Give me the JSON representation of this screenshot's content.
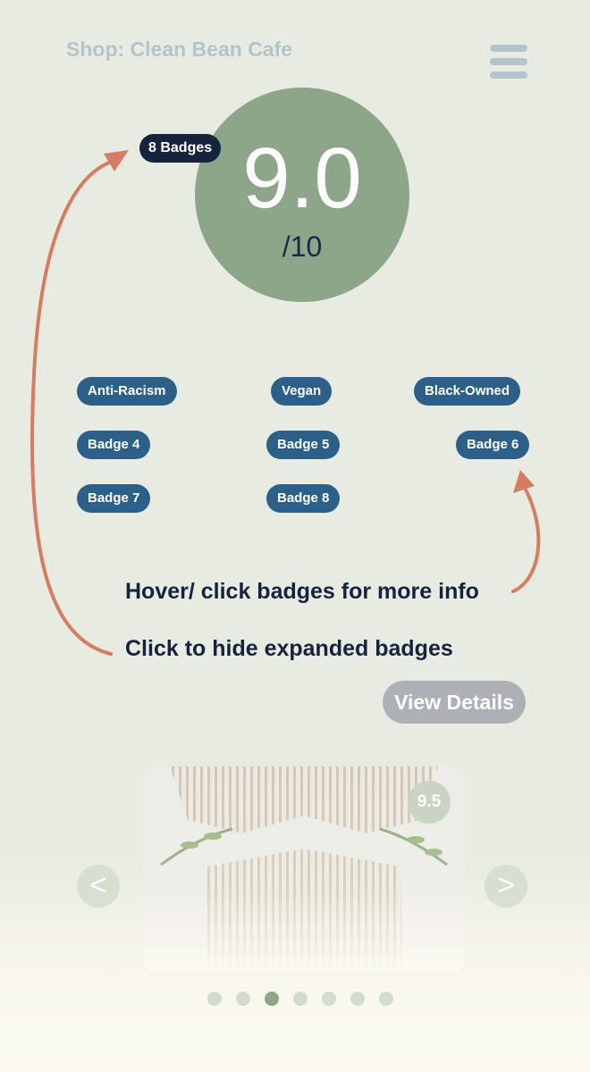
{
  "header": {
    "shop_title": "Shop: Clean Bean Cafe",
    "menu_icon": "hamburger-menu-icon"
  },
  "score": {
    "value": "9.0",
    "max": "/10",
    "badge_count_label": "8 Badges"
  },
  "badges": [
    "Anti-Racism",
    "Vegan",
    "Black-Owned",
    "Badge 4",
    "Badge 5",
    "Badge 6",
    "Badge 7",
    "Badge 8"
  ],
  "annotations": {
    "hover_note": "Hover/ click badges for more info",
    "hide_note": "Click to hide expanded badges"
  },
  "actions": {
    "view_details_label": "View Details"
  },
  "carousel": {
    "item_score": "9.5",
    "prev_label": "<",
    "next_label": ">",
    "dot_count": 7,
    "active_dot_index": 2
  },
  "colors": {
    "background": "#e8ebe1",
    "accent_green": "#8da589",
    "badge_blue": "#2c6089",
    "navy": "#16233f",
    "annotation_arrow": "#d47d62",
    "muted_title": "#b3c5cb"
  }
}
